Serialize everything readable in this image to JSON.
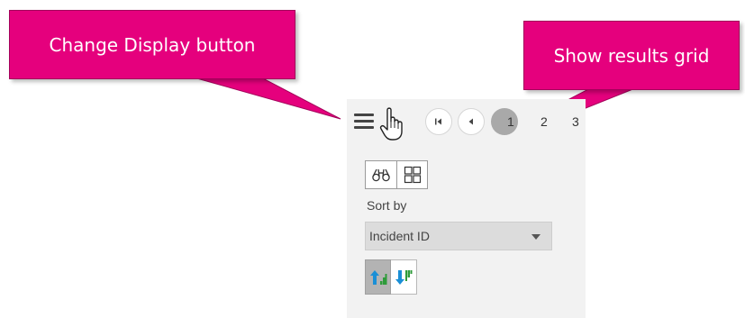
{
  "callouts": {
    "change_display": "Change Display button",
    "show_results_grid": "Show results grid"
  },
  "toolbar": {
    "menu_icon": "hamburger-icon",
    "cursor_icon": "hand-pointer-icon",
    "first_page_icon": "first-page-icon",
    "prev_page_icon": "previous-page-icon",
    "pages": [
      "1",
      "2",
      "3"
    ],
    "current_page": "1"
  },
  "view_toggle": {
    "binoculars_icon": "binoculars-icon",
    "grid_icon": "grid-icon"
  },
  "sort": {
    "label": "Sort by",
    "selected": "Incident ID",
    "ascending_icon": "sort-ascending-icon",
    "descending_icon": "sort-descending-icon"
  },
  "colors": {
    "callout": "#e5007d",
    "panel_bg": "#f2f2f2",
    "select_bg": "#dcdcdc"
  }
}
